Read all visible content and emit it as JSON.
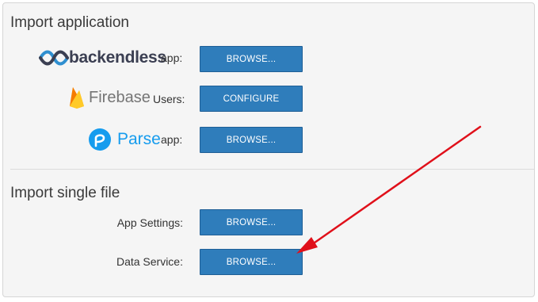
{
  "sections": {
    "import_application_title": "Import application",
    "import_single_file_title": "Import single file"
  },
  "rows": {
    "backendless": {
      "logo_text": "backendless",
      "suffix": "app:",
      "button": "BROWSE..."
    },
    "firebase": {
      "logo_text": "Firebase",
      "suffix": "Users:",
      "button": "CONFIGURE"
    },
    "parse": {
      "logo_text": "Parse",
      "suffix": "app:",
      "button": "BROWSE..."
    },
    "app_settings": {
      "label": "App Settings:",
      "button": "BROWSE..."
    },
    "data_service": {
      "label": "Data Service:",
      "button": "BROWSE..."
    }
  },
  "colors": {
    "button": "#2f7dbb",
    "arrow": "#e0101a",
    "firebase_flame": "#ffa000",
    "parse_blue": "#169cee",
    "backendless_blue": "#2f8fd0"
  },
  "icons": {
    "backendless": "backendless-logo-icon",
    "firebase": "firebase-flame-icon",
    "parse": "parse-logo-icon",
    "annotation": "red-arrow-annotation"
  }
}
